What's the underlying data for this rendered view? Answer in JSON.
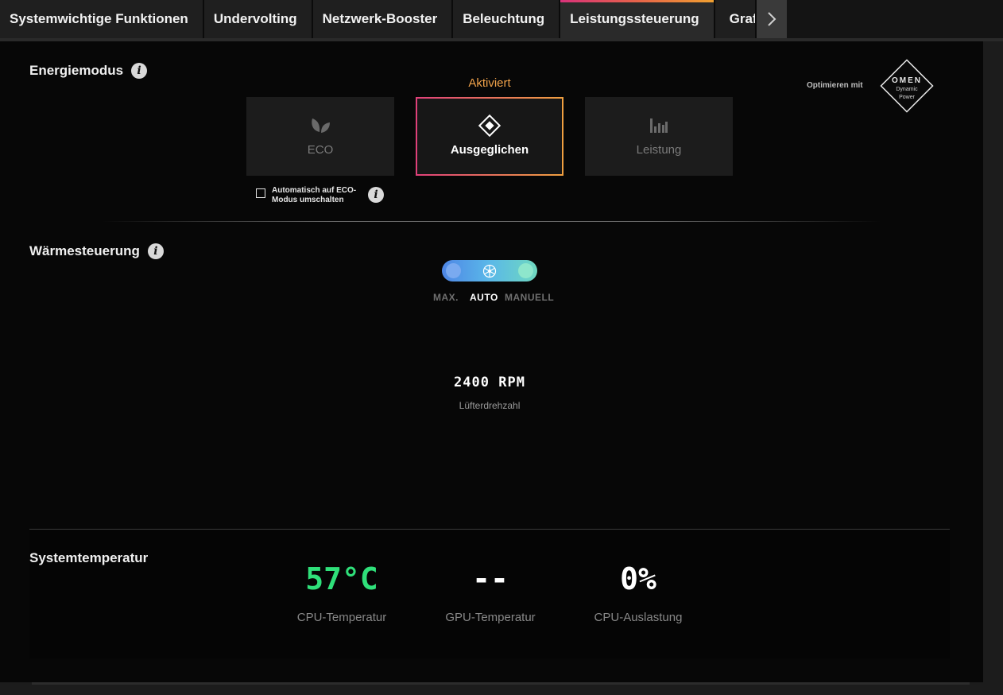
{
  "tabs": [
    {
      "label": "Systemwichtige Funktionen",
      "active": false
    },
    {
      "label": "Undervolting",
      "active": false
    },
    {
      "label": "Netzwerk-Booster",
      "active": false
    },
    {
      "label": "Beleuchtung",
      "active": false
    },
    {
      "label": "Leistungssteuerung",
      "active": true
    },
    {
      "label": "Grafi",
      "active": false
    }
  ],
  "energy": {
    "title": "Energiemodus",
    "activated_label": "Aktiviert",
    "modes": [
      {
        "label": "ECO",
        "icon": "leaf-icon"
      },
      {
        "label": "Ausgeglichen",
        "icon": "diamond-icon",
        "selected": true
      },
      {
        "label": "Leistung",
        "icon": "bar-chart-icon"
      }
    ],
    "auto_eco_label": "Automatisch auf ECO-Modus umschalten",
    "auto_eco_checked": false,
    "optimize_label": "Optimieren mit",
    "omen_logo": {
      "brand": "OMEN",
      "line1": "Dynamic",
      "line2": "Power"
    }
  },
  "thermal": {
    "title": "Wärmesteuerung",
    "options": [
      "MAX.",
      "AUTO",
      "MANUELL"
    ],
    "selected": "AUTO",
    "fan_speed": "2400 RPM",
    "fan_label": "Lüfterdrehzahl"
  },
  "system_temp": {
    "title": "Systemtemperatur",
    "cpu_temp": "57°C",
    "cpu_temp_label": "CPU-Temperatur",
    "gpu_temp": "--",
    "gpu_temp_label": "GPU-Temperatur",
    "cpu_load": "0%",
    "cpu_load_label": "CPU-Auslastung",
    "cpu_temp_color": "#2fe07a"
  }
}
